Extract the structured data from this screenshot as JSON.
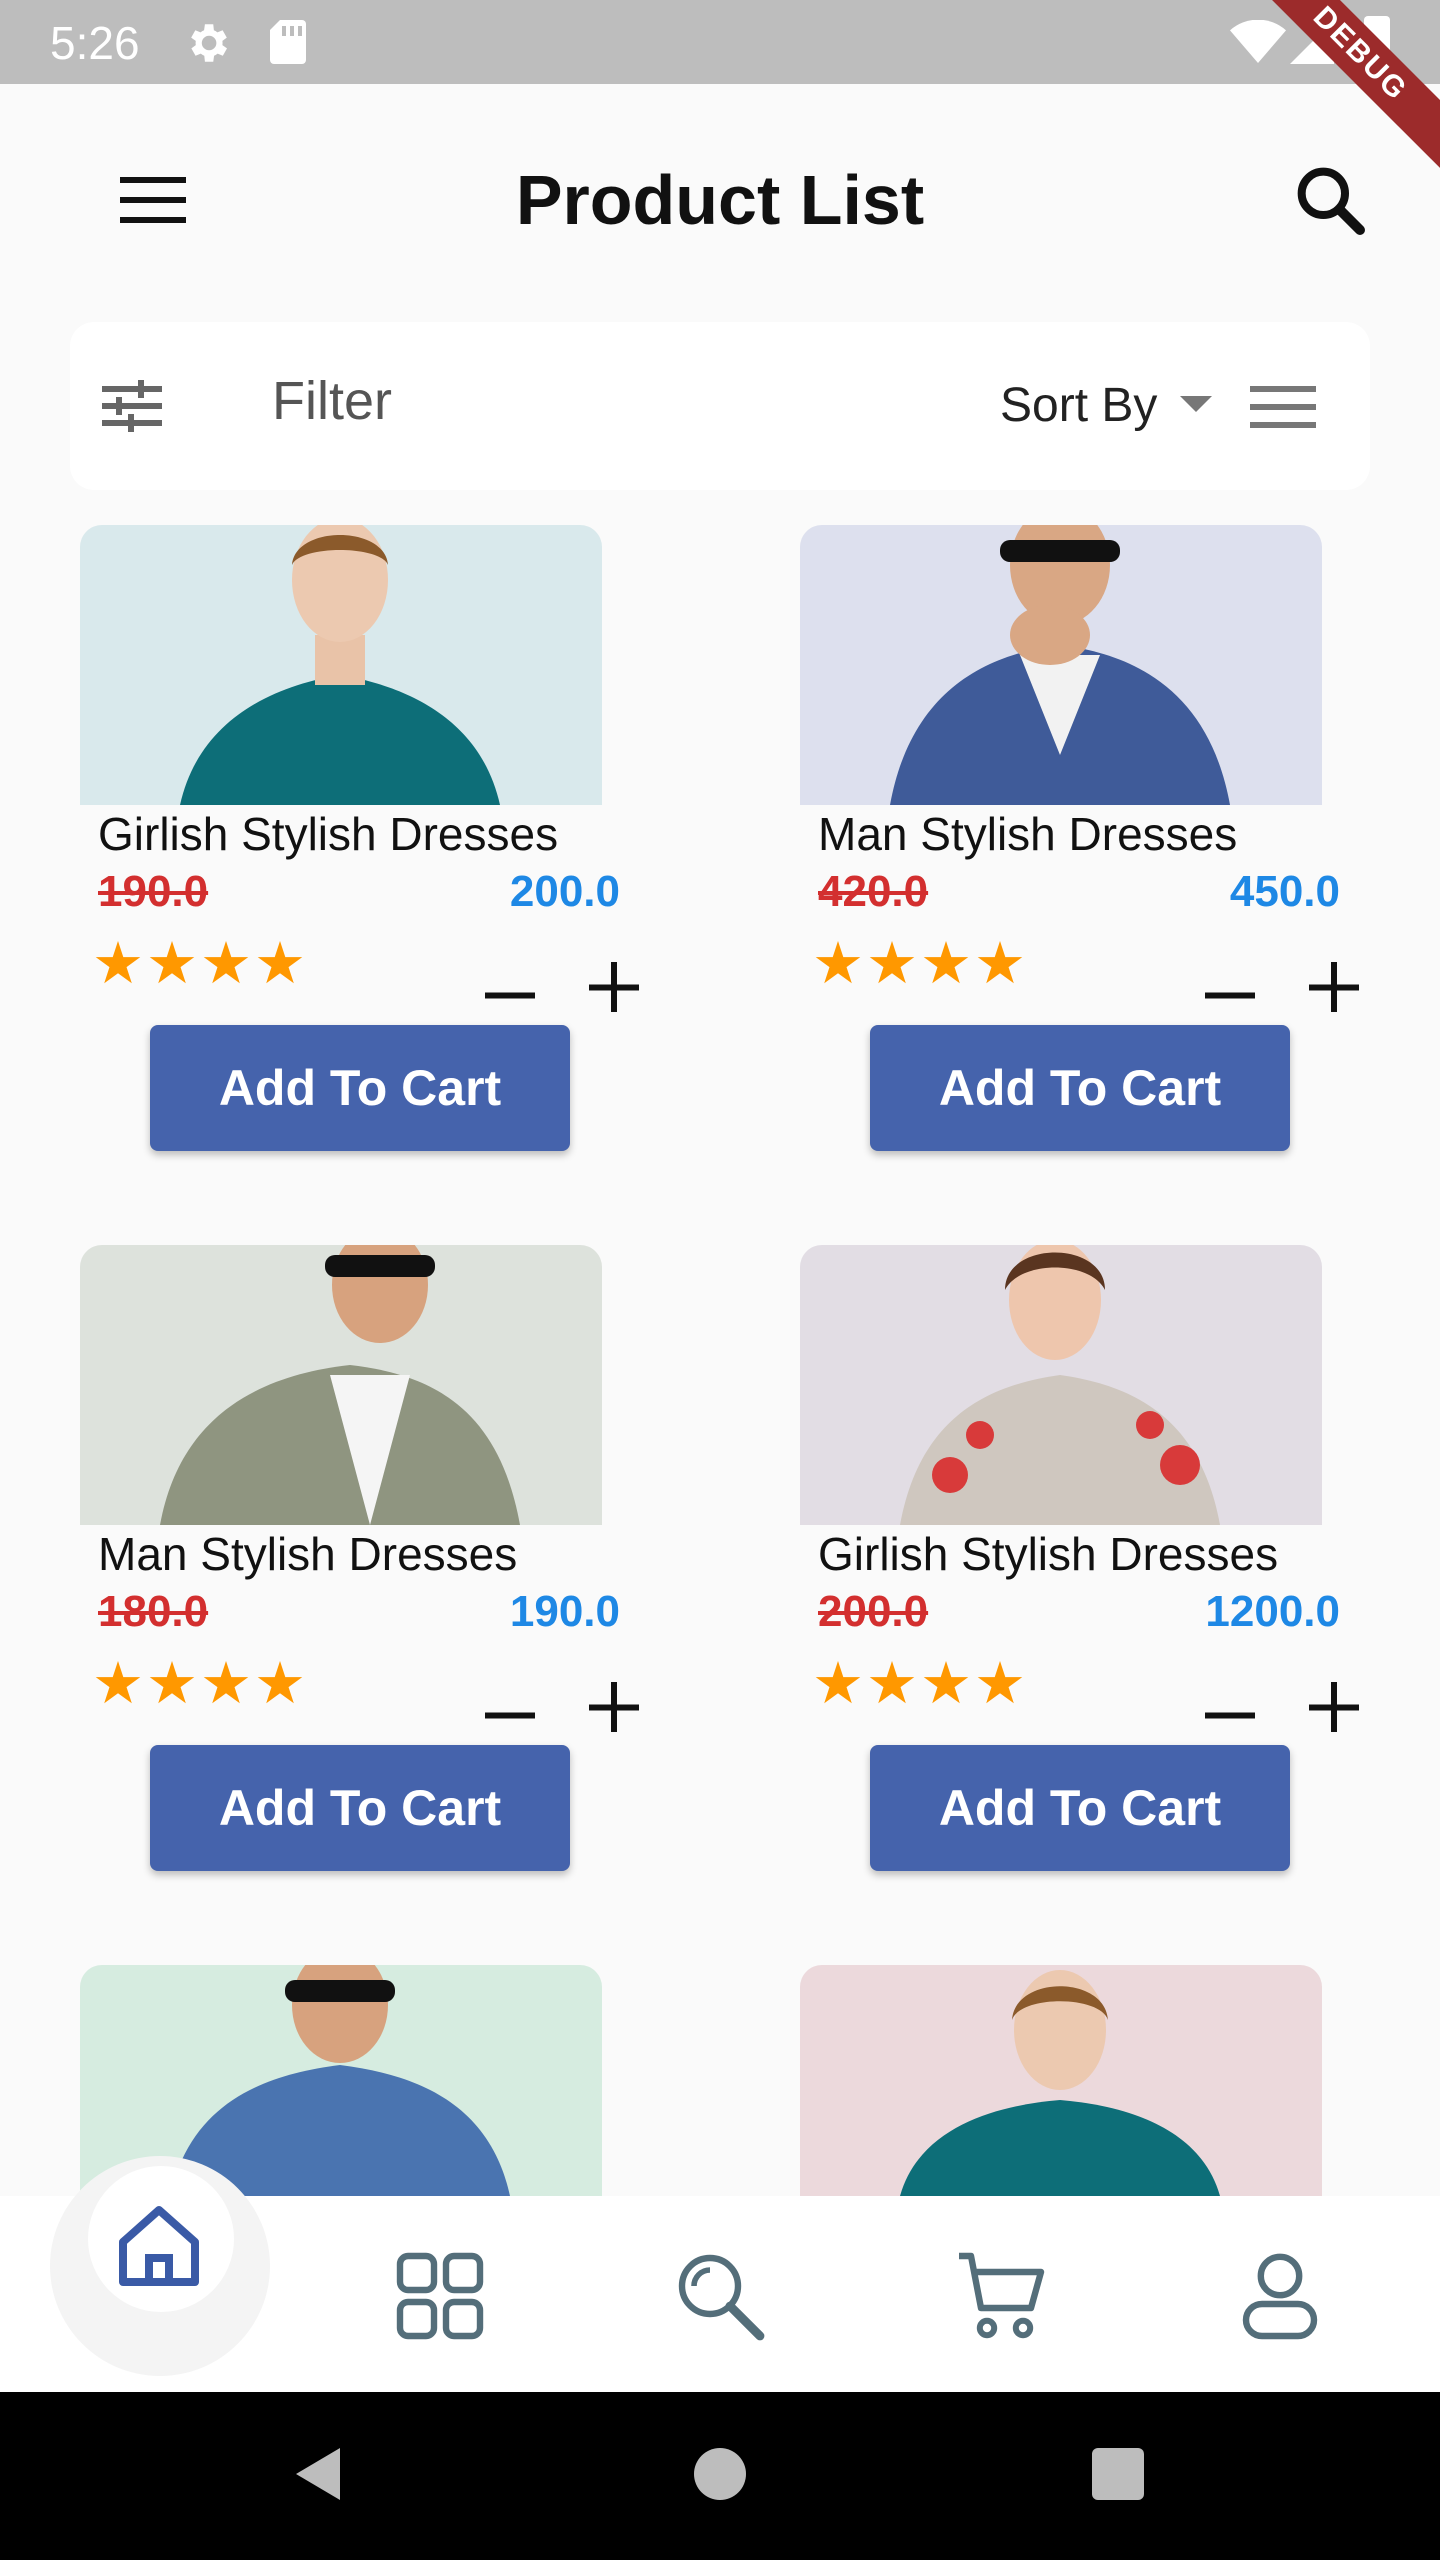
{
  "status_bar": {
    "time": "5:26",
    "debug_label": "DEBUG"
  },
  "header": {
    "title": "Product List",
    "menu_icon": "menu-icon",
    "search_icon": "search-icon"
  },
  "filter_bar": {
    "filter_label": "Filter",
    "sort_label": "Sort By"
  },
  "products": [
    {
      "name": "Girlish Stylish Dresses",
      "old_price": "190.0",
      "new_price": "200.0",
      "rating": "★★★★",
      "cart_label": "Add To Cart"
    },
    {
      "name": "Man Stylish Dresses",
      "old_price": "420.0",
      "new_price": "450.0",
      "rating": "★★★★",
      "cart_label": "Add To Cart"
    },
    {
      "name": "Man Stylish Dresses",
      "old_price": "180.0",
      "new_price": "190.0",
      "rating": "★★★★",
      "cart_label": "Add To Cart"
    },
    {
      "name": "Girlish Stylish Dresses",
      "old_price": "200.0",
      "new_price": "1200.0",
      "rating": "★★★★",
      "cart_label": "Add To Cart"
    }
  ],
  "bottom_nav": [
    "home-icon",
    "grid-icon",
    "search-icon",
    "cart-icon",
    "profile-icon"
  ],
  "colors": {
    "accent": "#4563ac",
    "old_price": "#d32f2f",
    "new_price": "#1e88e5",
    "star": "#ff9800"
  }
}
